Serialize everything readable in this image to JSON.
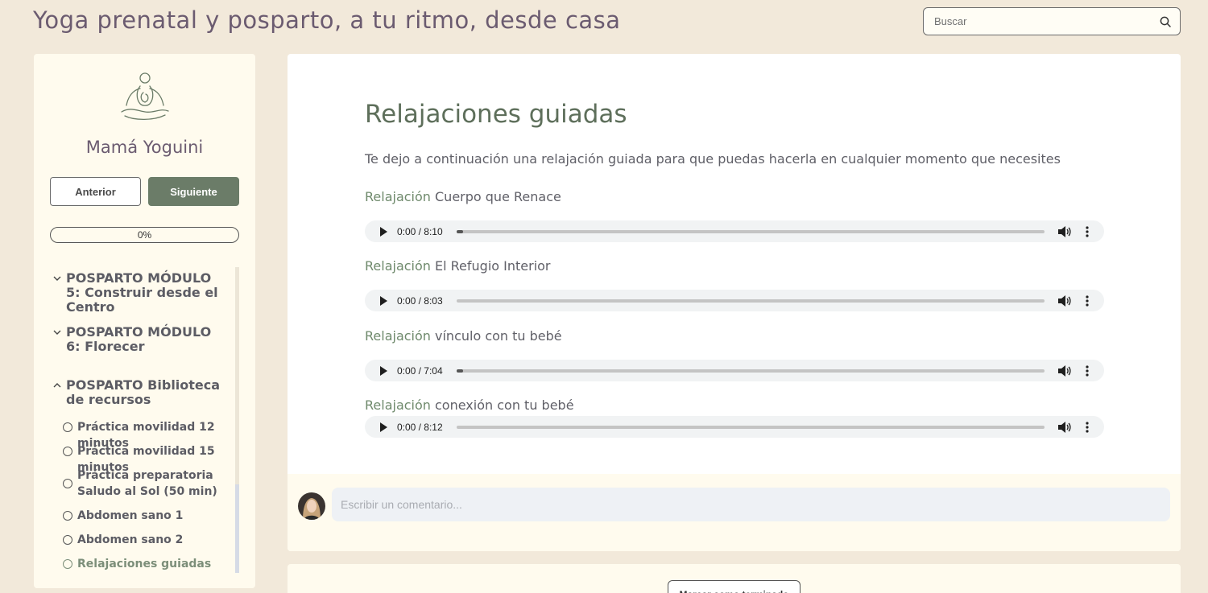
{
  "header": {
    "site_title": "Yoga prenatal y posparto, a tu ritmo, desde casa",
    "search_placeholder": "Buscar"
  },
  "sidebar": {
    "brand_name": "Mamá Yoguini",
    "prev_label": "Anterior",
    "next_label": "Siguiente",
    "progress_percent": 0,
    "progress_label": "0%",
    "modules": [
      {
        "title": "POSPARTO MÓDULO 5: Construir desde el Centro",
        "expanded": false
      },
      {
        "title": "POSPARTO MÓDULO 6: Florecer",
        "expanded": false
      },
      {
        "title": "POSPARTO Biblioteca de recursos",
        "expanded": true
      }
    ],
    "lessons": [
      {
        "label": "Práctica movilidad 12 minutos",
        "active": false
      },
      {
        "label": "Práctica movilidad 15 minutos",
        "active": false
      },
      {
        "label": "Práctica preparatoria Saludo al Sol (50 min)",
        "active": false
      },
      {
        "label": "Abdomen sano 1",
        "active": false
      },
      {
        "label": "Abdomen sano 2",
        "active": false
      },
      {
        "label": "Relajaciones guiadas",
        "active": true
      }
    ]
  },
  "main": {
    "title": "Relajaciones guiadas",
    "intro": "Te dejo a continuación una relajación guiada para que puedas hacerla en cualquier momento que necesites",
    "tracks": [
      {
        "prefix": "Relajación",
        "rest": " Cuerpo que Renace",
        "time": "0:00 / 8:10"
      },
      {
        "prefix": "Relajación",
        "rest": " El Refugio Interior",
        "time": "0:00 / 8:03"
      },
      {
        "prefix": "Relajación",
        "rest": " vínculo con tu bebé",
        "time": "0:00 / 7:04"
      },
      {
        "prefix": "Relajación",
        "rest": " conexión con tu bebé",
        "time": "0:00 / 8:12"
      }
    ],
    "comment_placeholder": "Escribir un comentario...",
    "complete_label": "Marcar como terminado"
  },
  "icons": {
    "search": "search-icon",
    "logo": "meditating-mother-logo",
    "chevron_collapsed": "chevron-down-icon",
    "chevron_expanded": "chevron-up-icon",
    "lesson_status": "circle-outline-icon",
    "play": "play-icon",
    "volume": "volume-icon",
    "more": "more-vertical-icon"
  },
  "colors": {
    "page_background": "#f2e9da",
    "panel_background": "#fffbee",
    "accent_green": "#6b7c68",
    "title_purple": "#6b5b70",
    "heading_green": "#5e6f5b"
  }
}
